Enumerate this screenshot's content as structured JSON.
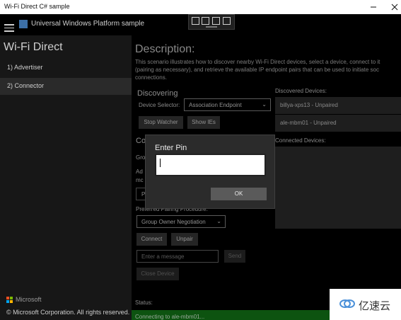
{
  "window": {
    "title": "Wi-Fi Direct C# sample",
    "controls": [
      "minimize-icon",
      "maximize-icon",
      "close-icon"
    ]
  },
  "app": {
    "title": "Universal Windows Platform sample",
    "icon": "app-logo-icon"
  },
  "sidebar": {
    "scenario_title": "Wi-Fi Direct",
    "items": [
      {
        "label": "1) Advertiser",
        "selected": false
      },
      {
        "label": "2) Connector",
        "selected": true
      }
    ],
    "brand": "Microsoft",
    "copyright": "© Microsoft Corporation. All rights reserved."
  },
  "main": {
    "description_title": "Description:",
    "description_lines": [
      "This scenario illustrates how to discover nearby Wi-Fi Direct devices, select a device, connect to it",
      "(pairing as necessary), and retrieve the available IP endpoint pairs that can be used to initiate soc",
      "connections."
    ],
    "discovering": {
      "heading": "Discovering",
      "device_selector_label": "Device Selector:",
      "device_selector_value": "Association Endpoint",
      "stop_watcher_label": "Stop Watcher",
      "show_ies_label": "Show IEs"
    },
    "connecting": {
      "heading_fragment": "Co",
      "group_fragment": "Gro",
      "ad_fragment_1": "Ad",
      "ad_fragment_2": "mc",
      "p_fragment": "P",
      "preferred_pairing_label": "Preferred Pairing Procedure:",
      "pairing_value": "Group Owner Negotiation",
      "connect_label": "Connect",
      "unpair_label": "Unpair",
      "message_placeholder": "Enter a message",
      "send_label": "Send",
      "close_device_label": "Close Device"
    },
    "discovered": {
      "label": "Discovered Devices:",
      "items": [
        "billya-xps13 - Unpaired",
        "ale-mbm01 - Unpaired"
      ]
    },
    "connected": {
      "label": "Connected Devices:"
    },
    "status": {
      "label": "Status:",
      "message": "Connecting to ale-mbm01...",
      "color": "#14801a"
    }
  },
  "dialog": {
    "title": "Enter Pin",
    "pin_value": "",
    "ok_label": "OK"
  },
  "watermark": {
    "text": "亿速云"
  },
  "colors": {
    "background": "#000000",
    "sidebar": "#171717",
    "accent_status": "#14801a"
  }
}
